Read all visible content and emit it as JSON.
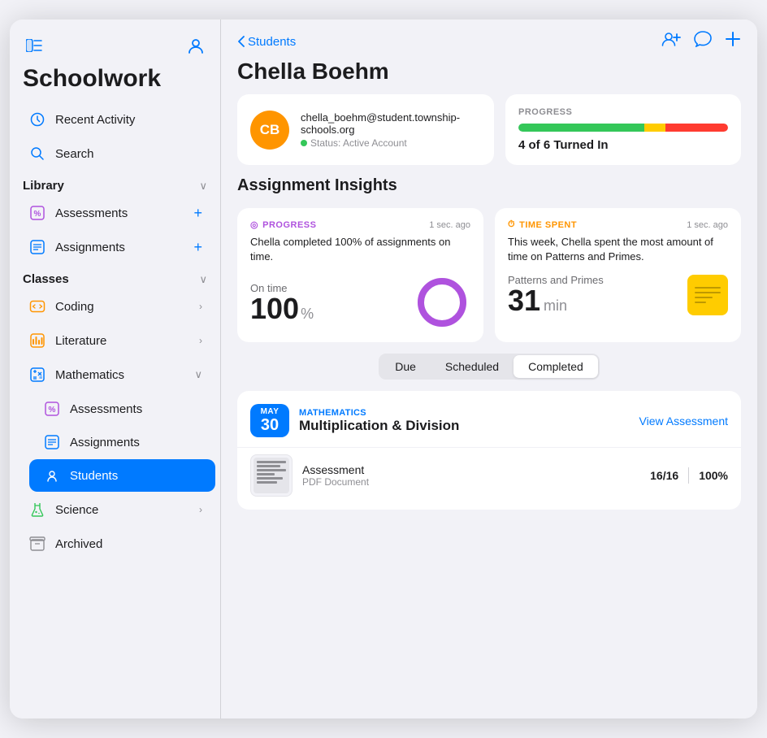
{
  "app": {
    "title": "Schoolwork"
  },
  "sidebar": {
    "icons": {
      "sidebar_toggle": "☰",
      "profile": "👤"
    },
    "nav": [
      {
        "id": "recent-activity",
        "label": "Recent Activity",
        "icon": "🕐"
      },
      {
        "id": "search",
        "label": "Search",
        "icon": "🔍"
      }
    ],
    "library": {
      "title": "Library",
      "items": [
        {
          "id": "lib-assessments",
          "label": "Assessments",
          "icon": "%",
          "icon_color": "purple"
        },
        {
          "id": "lib-assignments",
          "label": "Assignments",
          "icon": "≡",
          "icon_color": "blue"
        }
      ]
    },
    "classes": {
      "title": "Classes",
      "items": [
        {
          "id": "coding",
          "label": "Coding",
          "icon": "□",
          "icon_color": "orange",
          "has_chevron": true
        },
        {
          "id": "literature",
          "label": "Literature",
          "icon": "📊",
          "icon_color": "orange",
          "has_chevron": true
        },
        {
          "id": "mathematics",
          "label": "Mathematics",
          "icon": "⊞",
          "icon_color": "blue",
          "expanded": true,
          "sub_items": [
            {
              "id": "math-assessments",
              "label": "Assessments",
              "icon": "%",
              "icon_color": "purple"
            },
            {
              "id": "math-assignments",
              "label": "Assignments",
              "icon": "≡",
              "icon_color": "blue"
            },
            {
              "id": "math-students",
              "label": "Students",
              "icon": "👤",
              "icon_color": "blue",
              "active": true
            }
          ]
        },
        {
          "id": "science",
          "label": "Science",
          "icon": "✳",
          "icon_color": "green",
          "has_chevron": true
        }
      ]
    },
    "archived": {
      "id": "archived",
      "label": "Archived",
      "icon": "📦"
    }
  },
  "main": {
    "back_label": "Students",
    "student_name": "Chella Boehm",
    "student": {
      "initials": "CB",
      "email": "chella_boehm@student.township-schools.org",
      "status_label": "Status: Active Account"
    },
    "progress": {
      "label": "PROGRESS",
      "text": "4 of 6 Turned In",
      "green_pct": 60,
      "yellow_pct": 10,
      "red_pct": 30
    },
    "insights": {
      "title": "Assignment Insights",
      "cards": [
        {
          "id": "progress-insight",
          "type_label": "PROGRESS",
          "type_icon": "◎",
          "timestamp": "1 sec. ago",
          "description": "Chella completed 100% of assignments on time.",
          "metric_label": "On time",
          "metric_value": "100",
          "metric_unit": "%"
        },
        {
          "id": "time-insight",
          "type_label": "TIME SPENT",
          "type_icon": "⏱",
          "timestamp": "1 sec. ago",
          "description": "This week, Chella spent the most amount of time on Patterns and Primes.",
          "metric_subject": "Patterns and Primes",
          "metric_value": "31",
          "metric_unit": "min"
        }
      ]
    },
    "filter_tabs": [
      {
        "id": "due",
        "label": "Due"
      },
      {
        "id": "scheduled",
        "label": "Scheduled"
      },
      {
        "id": "completed",
        "label": "Completed",
        "active": true
      }
    ],
    "assignments": [
      {
        "id": "assignment-1",
        "date_month": "MAY",
        "date_day": "30",
        "subject": "MATHEMATICS",
        "name": "Multiplication & Division",
        "action_label": "View Assessment",
        "document": {
          "name": "Assessment",
          "type": "PDF Document",
          "score": "16/16",
          "percent": "100%"
        }
      }
    ]
  },
  "actions": {
    "add_student": "person.badge.plus",
    "comment": "message",
    "add": "plus"
  }
}
